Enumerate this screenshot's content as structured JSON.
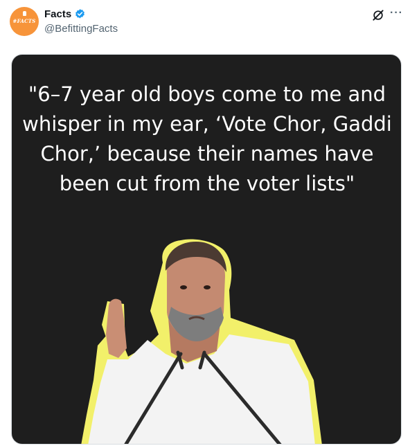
{
  "tweet": {
    "author_name": "Facts",
    "handle": "@BefittingFacts",
    "avatar_text": "#FACTS",
    "verified": true
  },
  "media": {
    "quote": "\"6–7 year old boys come to me and whisper in my ear, ‘Vote Chor, Gaddi Chor,’ because their names have been cut from the voter lists\""
  },
  "icons": {
    "verified": "verified-badge-icon",
    "grok": "grok-icon",
    "more": "more-icon"
  },
  "colors": {
    "verified_badge": "#1d9bf0",
    "avatar_bg": "#f7943a",
    "media_bg": "#1e1e1e",
    "figure_outline": "#f2f06a"
  }
}
